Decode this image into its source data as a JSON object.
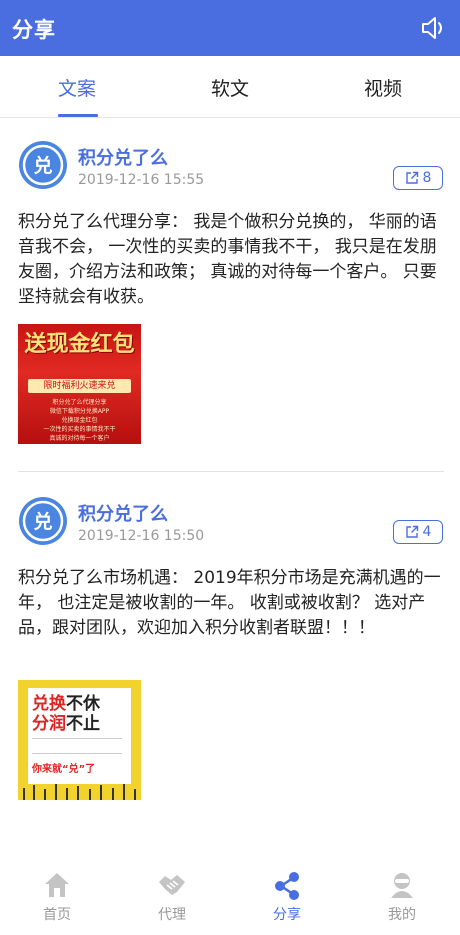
{
  "header": {
    "title": "分享",
    "speaker_icon": "speaker-icon"
  },
  "tabs": [
    {
      "label": "文案",
      "active": true
    },
    {
      "label": "软文",
      "active": false
    },
    {
      "label": "视频",
      "active": false
    }
  ],
  "posts": [
    {
      "author": "积分兑了么",
      "time": "2019-12-16 15:55",
      "share_count": "8",
      "text": "积分兑了么代理分享：  我是个做积分兑换的， 华丽的语音我不会， 一次性的买卖的事情我不干， 我只是在发朋友圈，介绍方法和政策；  真诚的对待每一个客户。  只要坚持就会有收获。",
      "image": {
        "headline": "送现金红包",
        "banner": "限时福利火速来兑",
        "lines": [
          "积分兑了么代理分享",
          "微信下载积分兑换APP",
          "兑换现金红包",
          "一次性的买卖的事情我不干",
          "真诚的对待每一个客户"
        ]
      }
    },
    {
      "author": "积分兑了么",
      "time": "2019-12-16 15:50",
      "share_count": "4",
      "text": "积分兑了么市场机遇： 2019年积分市场是充满机遇的一年，  也注定是被收割的一年。  收割或被收割？  选对产品，跟对团队，欢迎加入积分收割者联盟！！！",
      "image": {
        "line1a": "兑换",
        "line1b": "不休",
        "line2a": "分润",
        "line2b": "不止",
        "footer": "你来就“兑”了"
      }
    }
  ],
  "bottom_nav": [
    {
      "label": "首页",
      "icon": "home-icon",
      "active": false
    },
    {
      "label": "代理",
      "icon": "handshake-icon",
      "active": false
    },
    {
      "label": "分享",
      "icon": "share-icon",
      "active": true
    },
    {
      "label": "我的",
      "icon": "user-icon",
      "active": false
    }
  ],
  "colors": {
    "accent": "#4a6ee0",
    "muted": "#999999",
    "text": "#222222",
    "poster_red": "#d81e1e",
    "poster_yellow": "#f2d22c"
  }
}
